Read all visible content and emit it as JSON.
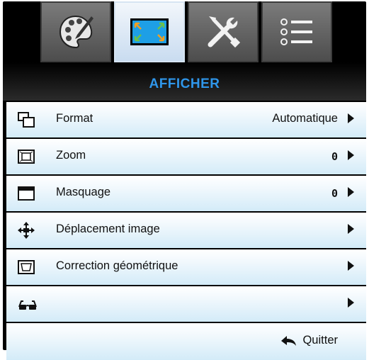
{
  "tabs": [
    {
      "name": "image",
      "icon": "palette-icon",
      "active": false
    },
    {
      "name": "display",
      "icon": "screen-icon",
      "active": true
    },
    {
      "name": "settings",
      "icon": "tools-icon",
      "active": false
    },
    {
      "name": "options",
      "icon": "list-icon",
      "active": false
    }
  ],
  "header": {
    "title": "AFFICHER"
  },
  "menu": [
    {
      "label": "Format",
      "value": "Automatique",
      "icon": "format-icon"
    },
    {
      "label": "Zoom",
      "value": "0",
      "icon": "zoom-icon"
    },
    {
      "label": "Masquage",
      "value": "0",
      "icon": "mask-icon"
    },
    {
      "label": "Déplacement image",
      "value": "",
      "icon": "move-icon"
    },
    {
      "label": "Correction géométrique",
      "value": "",
      "icon": "keystone-icon"
    },
    {
      "label": "",
      "value": "",
      "icon": "3d-glasses-icon"
    }
  ],
  "footer": {
    "quit_label": "Quitter",
    "icon": "return-icon"
  },
  "colors": {
    "accent": "#2f96ea",
    "row_gradient_end": "#d3ebf8",
    "active_tab": "#e4eef8"
  }
}
